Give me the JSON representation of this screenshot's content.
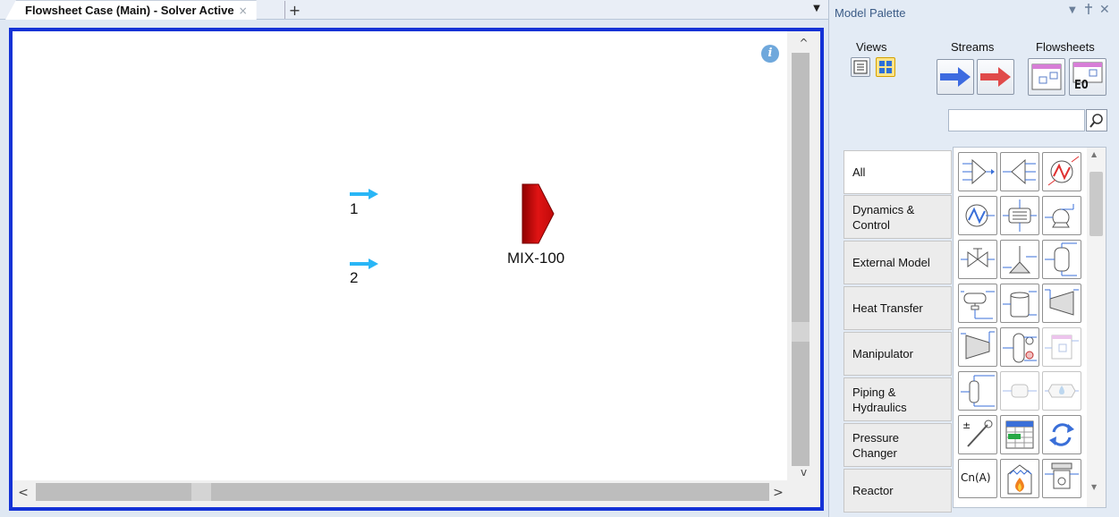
{
  "document": {
    "tab_title": "Flowsheet Case (Main) - Solver Active",
    "tab_close": "×",
    "new_tab": "+",
    "tab_menu": "▼"
  },
  "flowsheet": {
    "streams": [
      {
        "label": "1"
      },
      {
        "label": "2"
      }
    ],
    "mixer": {
      "label": "MIX-100"
    },
    "info_glyph": "i",
    "stream_color": "#29b6f6",
    "mixer_color": "#d10f0f",
    "border_color": "#1432d6"
  },
  "scrollbars": {
    "up": "^",
    "down": "v",
    "left": "<",
    "right": ">"
  },
  "palette": {
    "title": "Model Palette",
    "menu_glyph": "▼",
    "pin_glyph": "ᵸ",
    "close_glyph": "✕",
    "groups": {
      "views": "Views",
      "streams": "Streams",
      "flowsheets": "Flowsheets",
      "eo_badge": "EO"
    },
    "search": {
      "placeholder": "",
      "value": ""
    },
    "categories": [
      {
        "label": "All"
      },
      {
        "label": "Dynamics & Control"
      },
      {
        "label": "External Model"
      },
      {
        "label": "Heat Transfer"
      },
      {
        "label": "Manipulator"
      },
      {
        "label": "Piping & Hydraulics"
      },
      {
        "label": "Pressure Changer"
      },
      {
        "label": "Reactor"
      }
    ],
    "operations": [
      {
        "icon": "mixer-op-icon"
      },
      {
        "icon": "tee-op-icon"
      },
      {
        "icon": "heater-op-icon"
      },
      {
        "icon": "cooler-op-icon"
      },
      {
        "icon": "heat-exchanger-op-icon"
      },
      {
        "icon": "pump-op-icon"
      },
      {
        "icon": "valve-op-icon"
      },
      {
        "icon": "relief-valve-op-icon"
      },
      {
        "icon": "separator-op-icon"
      },
      {
        "icon": "three-phase-separator-op-icon"
      },
      {
        "icon": "tank-op-icon"
      },
      {
        "icon": "compressor-op-icon"
      },
      {
        "icon": "expander-op-icon"
      },
      {
        "icon": "column-op-icon"
      },
      {
        "icon": "sub-flowsheet-op-icon"
      },
      {
        "icon": "component-splitter-op-icon"
      },
      {
        "icon": "pipe-segment-op-icon"
      },
      {
        "icon": "liquid-drop-op-icon"
      },
      {
        "icon": "adjust-op-icon"
      },
      {
        "icon": "spreadsheet-op-icon"
      },
      {
        "icon": "recycle-op-icon"
      },
      {
        "icon": "cn-a-op-icon"
      },
      {
        "icon": "fired-heater-op-icon"
      },
      {
        "icon": "filter-op-icon"
      }
    ],
    "cn_label": "Cn(A)"
  }
}
